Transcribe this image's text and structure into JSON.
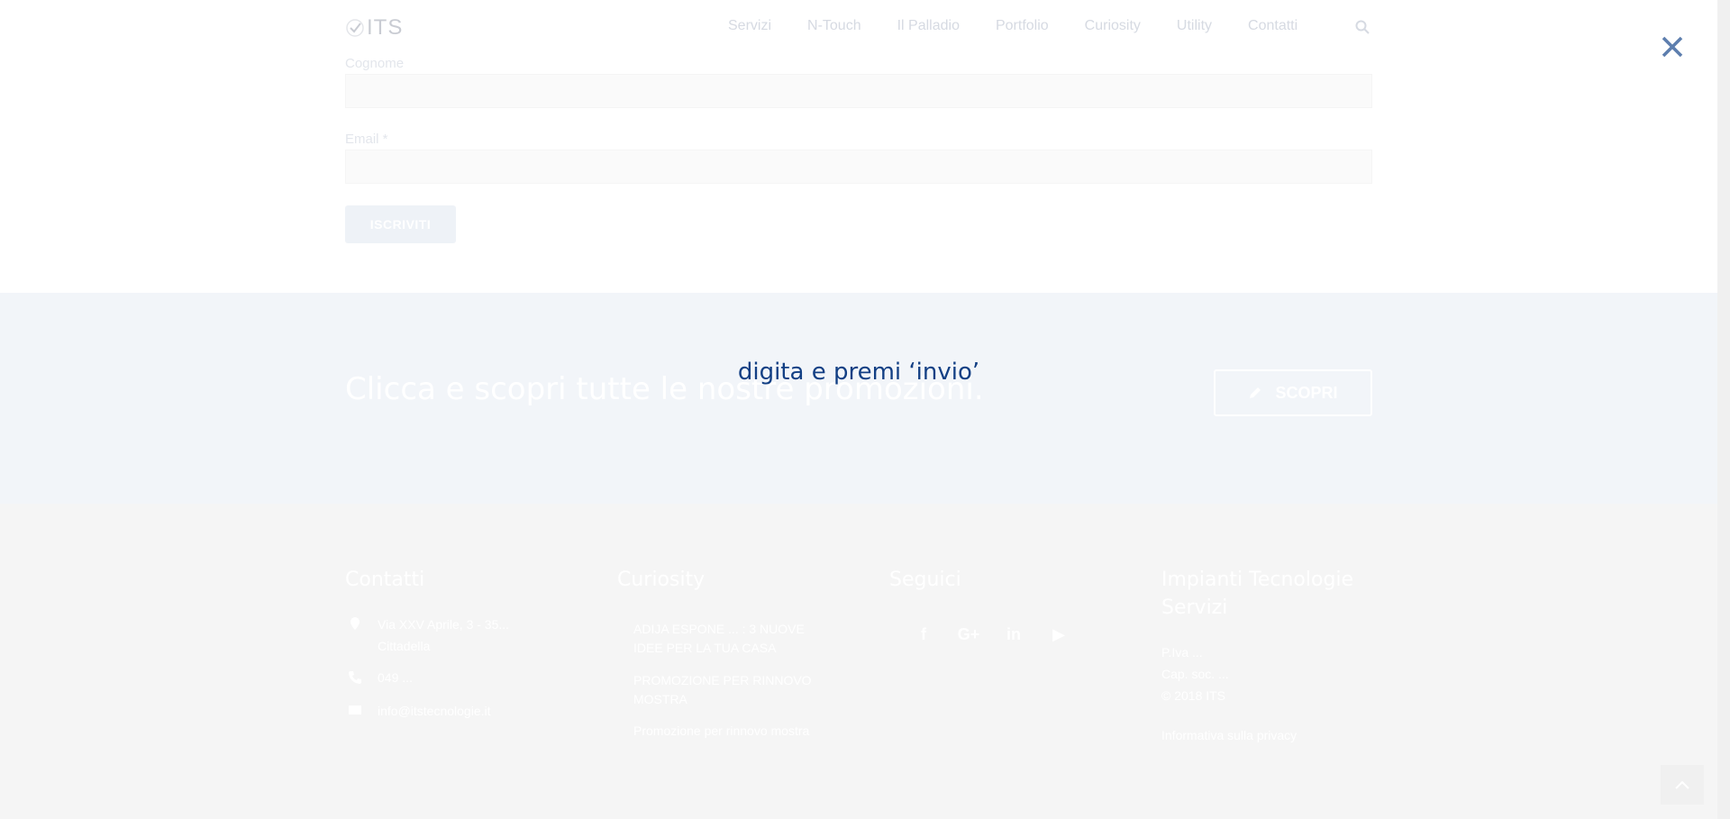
{
  "header": {
    "logo_text": "ITS",
    "nav": [
      "Servizi",
      "N-Touch",
      "Il Palladio",
      "Portfolio",
      "Curiosity",
      "Utility",
      "Contatti"
    ]
  },
  "form": {
    "cognome_label": "Cognome",
    "email_label": "Email *",
    "submit_label": "ISCRIVITI"
  },
  "promo": {
    "text": "Clicca e scopri tutte le nostre promozioni.",
    "button_label": "SCOPRI"
  },
  "footer": {
    "contatti": {
      "title": "Contatti",
      "address_line1": "Via XXV Aprile, 3 - 35... ",
      "address_line2": "Cittadella",
      "phone": "049 ...",
      "email": "info@itstecnologie.it"
    },
    "curiosity": {
      "title": "Curiosity",
      "items": [
        "ADIJA ESPONE ... : 3 NUOVE IDEE PER LA TUA CASA",
        "PROMOZIONE PER RINNOVO MOSTRA",
        "Promozione per rinnovo mostra"
      ]
    },
    "seguici": {
      "title": "Seguici"
    },
    "company": {
      "title_line1": "Impianti Tecnologie",
      "title_line2": "Servizi",
      "line1": "P.Iva ... ",
      "line2": "Cap. soc. ...",
      "line3": "© 2018 ITS",
      "privacy": "Informativa sulla privacy"
    }
  },
  "overlay": {
    "search_hint": "digita e premi ‘invio’"
  },
  "colors": {
    "hint": "#123f84",
    "close": "#123f84"
  }
}
